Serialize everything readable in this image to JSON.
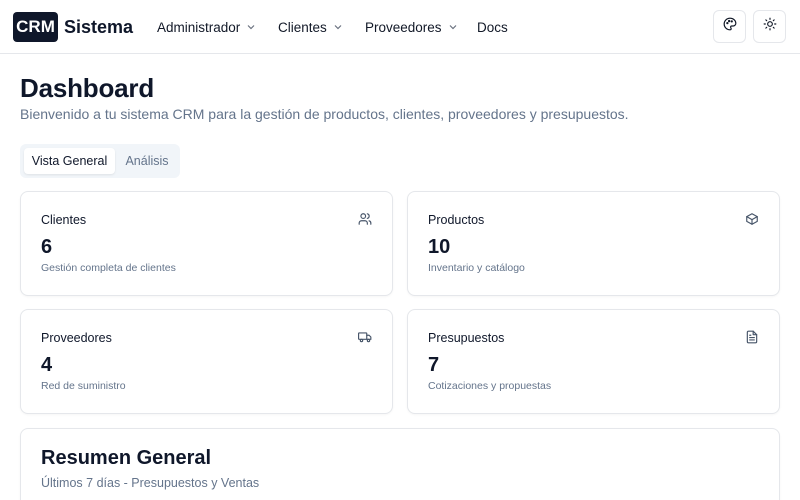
{
  "brand": {
    "badge": "CRM",
    "name": "Sistema"
  },
  "nav": {
    "administrador": "Administrador",
    "clientes": "Clientes",
    "proveedores": "Proveedores",
    "docs": "Docs"
  },
  "header_buttons": {
    "theme_icon": "palette-icon",
    "mode_icon": "sun-icon"
  },
  "page": {
    "title": "Dashboard",
    "subtitle": "Bienvenido a tu sistema CRM para la gestión de productos, clientes, proveedores y presupuestos."
  },
  "tabs": {
    "overview": "Vista General",
    "analysis": "Análisis",
    "active": "Vista General"
  },
  "cards": {
    "clientes": {
      "title": "Clientes",
      "value": "6",
      "desc": "Gestión completa de clientes",
      "icon": "users-icon"
    },
    "productos": {
      "title": "Productos",
      "value": "10",
      "desc": "Inventario y catálogo",
      "icon": "package-icon"
    },
    "proveedores": {
      "title": "Proveedores",
      "value": "4",
      "desc": "Red de suministro",
      "icon": "truck-icon"
    },
    "presupuestos": {
      "title": "Presupuestos",
      "value": "7",
      "desc": "Cotizaciones y propuestas",
      "icon": "file-text-icon"
    }
  },
  "summary": {
    "title": "Resumen General",
    "subtitle": "Últimos 7 días - Presupuestos y Ventas"
  },
  "colors": {
    "brand_dark": "#0f172a",
    "muted_text": "#64748b",
    "border": "#e5e7eb",
    "tab_bg": "#f1f5f9"
  }
}
